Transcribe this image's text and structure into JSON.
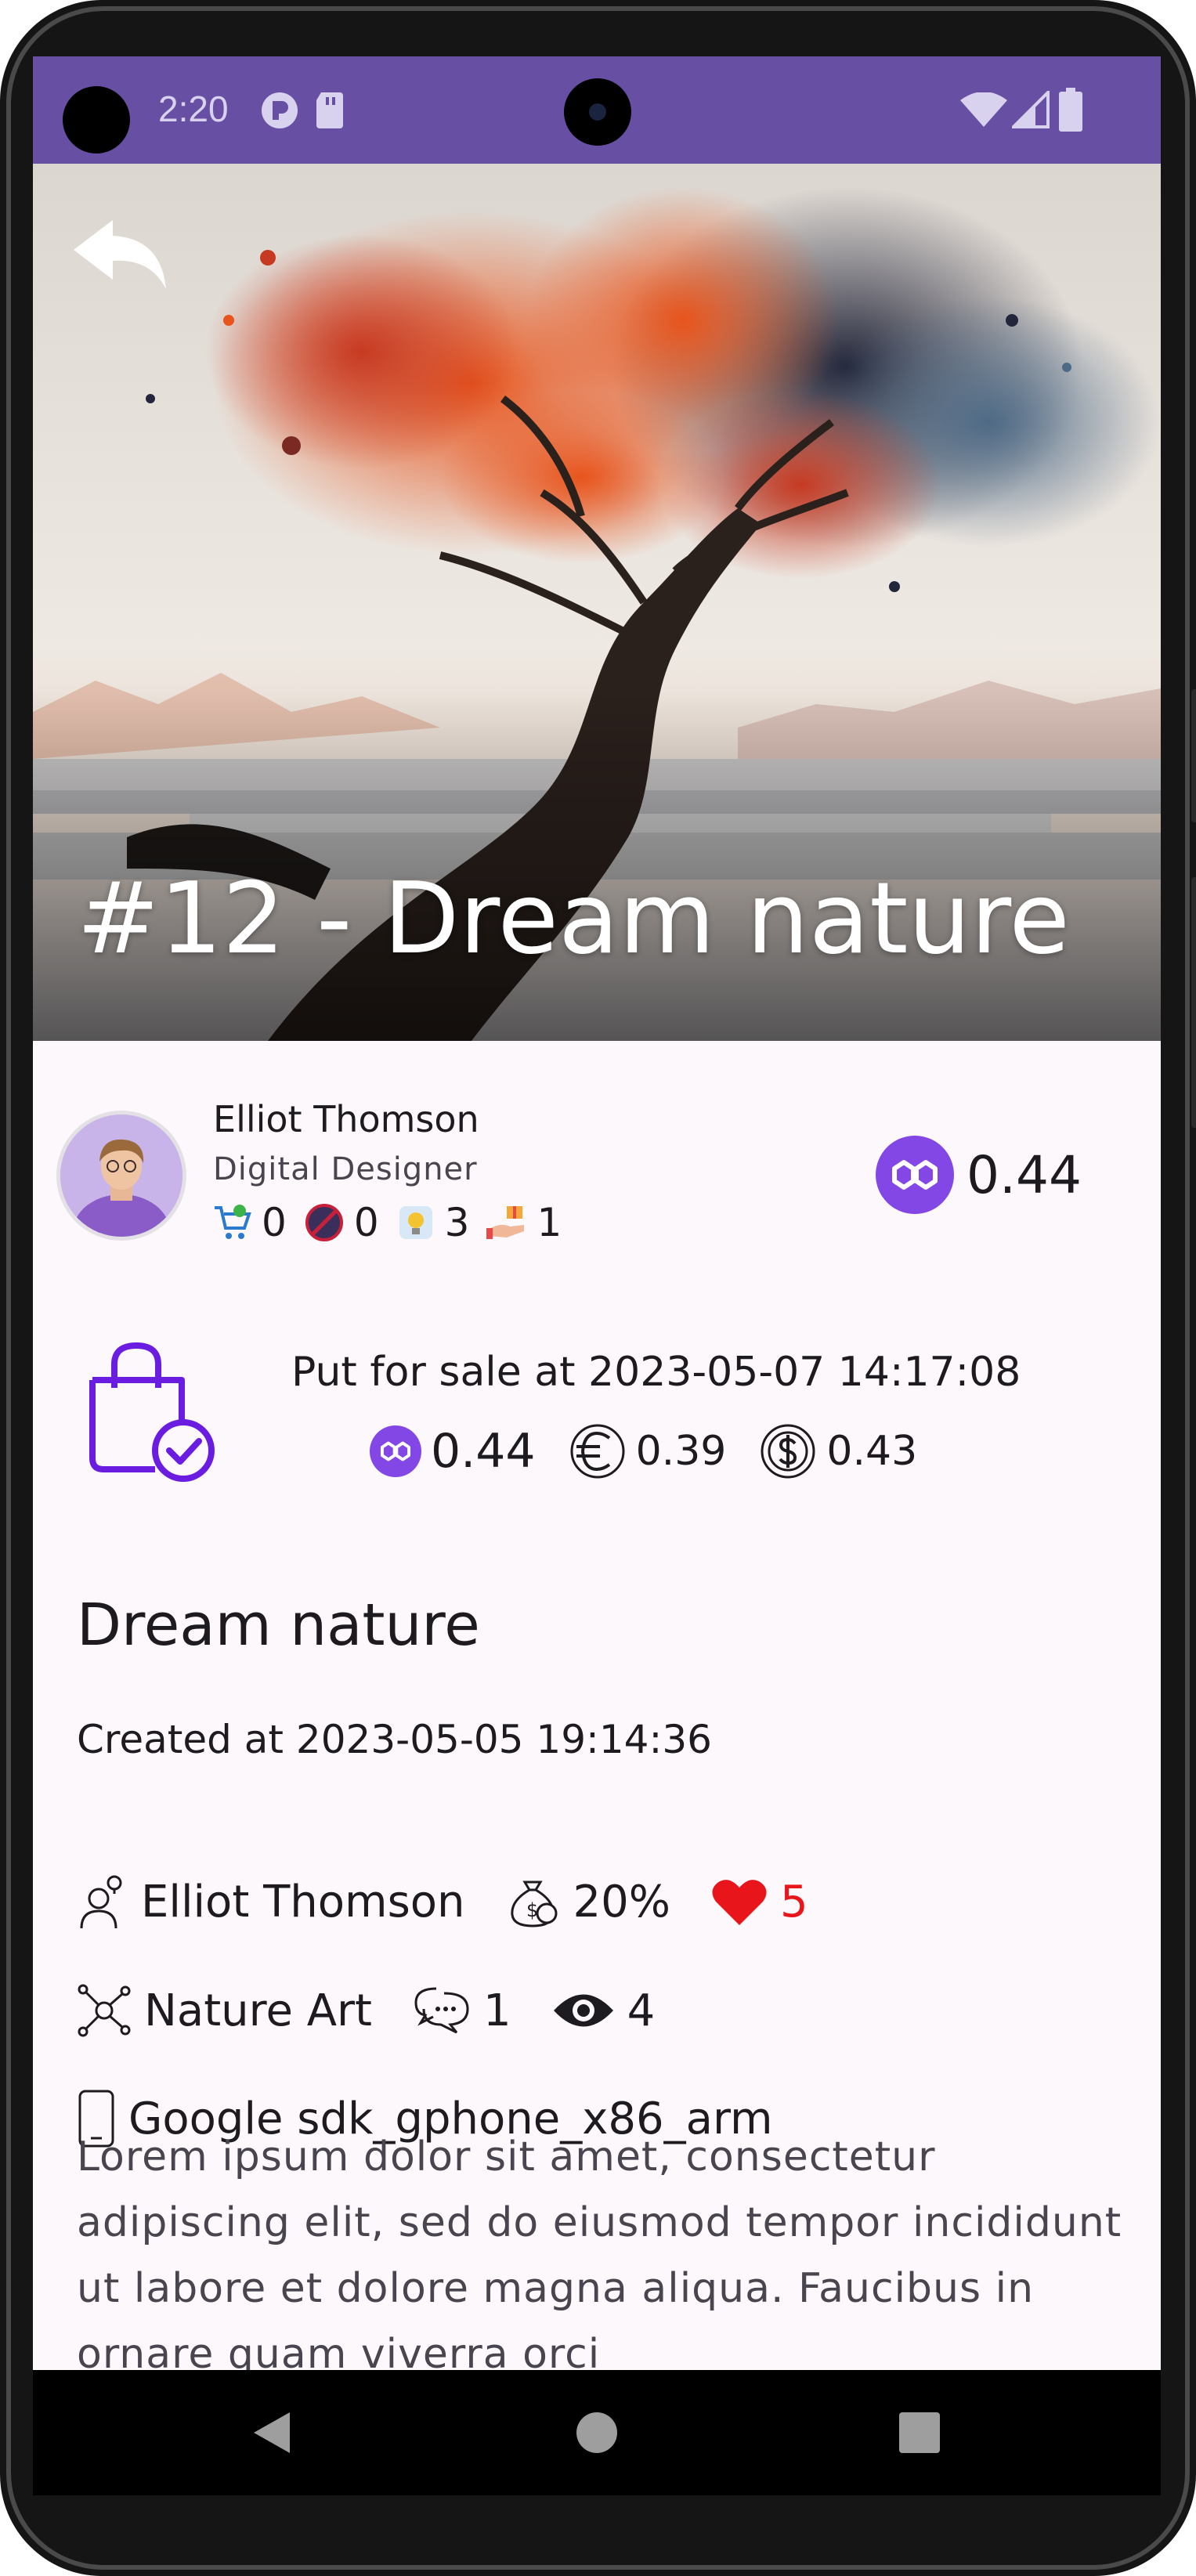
{
  "status_bar": {
    "time": "2:20"
  },
  "hero": {
    "title": "#12 - Dream nature"
  },
  "artist": {
    "name": "Elliot Thomson",
    "role": "Digital Designer",
    "stats": [
      {
        "icon": "cart-icon",
        "value": "0"
      },
      {
        "icon": "no-entry-icon",
        "value": "0"
      },
      {
        "icon": "idea-icon",
        "value": "3"
      },
      {
        "icon": "hand-gift-icon",
        "value": "1"
      }
    ]
  },
  "price_top": {
    "icon": "polygon-icon",
    "value": "0.44"
  },
  "sale": {
    "text": "Put for sale at 2023-05-07 14:17:08",
    "prices": {
      "matic": "0.44",
      "eur": "0.39",
      "usd": "0.43"
    }
  },
  "details": {
    "title": "Dream nature",
    "created": "Created at 2023-05-05 19:14:36",
    "creator": "Elliot Thomson",
    "royalty": "20%",
    "likes": "5",
    "category": "Nature Art",
    "comments": "1",
    "views": "4",
    "device": "Google sdk_gphone_x86_arm",
    "description": "Lorem ipsum dolor sit amet, consectetur adipiscing elit, sed do eiusmod tempor incididunt ut labore et dolore magna aliqua. Faucibus in ornare quam viverra orci"
  },
  "colors": {
    "status_bar": "#6750a4",
    "polygon": "#8247e5",
    "bag": "#6a1de0",
    "heart": "#e8151b",
    "surface": "#fdf8fc"
  }
}
